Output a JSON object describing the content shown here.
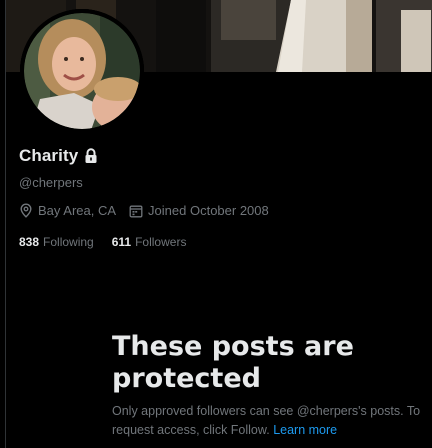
{
  "profile": {
    "name": "Charity",
    "handle": "@cherpers",
    "location": "Bay Area, CA",
    "joined": "Joined October 2008",
    "following_count": "838",
    "following_label": "Following",
    "followers_count": "611",
    "followers_label": "Followers"
  },
  "protected": {
    "title": "These posts are protected",
    "body": "Only approved followers can see @cherpers's posts. To request access, click Follow.",
    "learn_more": "Learn more"
  },
  "icons": {
    "lock": "lock-icon",
    "location": "location-pin-icon",
    "calendar": "calendar-icon"
  },
  "colors": {
    "background": "#000000",
    "text_primary": "#e7e9ea",
    "text_secondary": "#71767b",
    "link": "#1d9bf0"
  }
}
